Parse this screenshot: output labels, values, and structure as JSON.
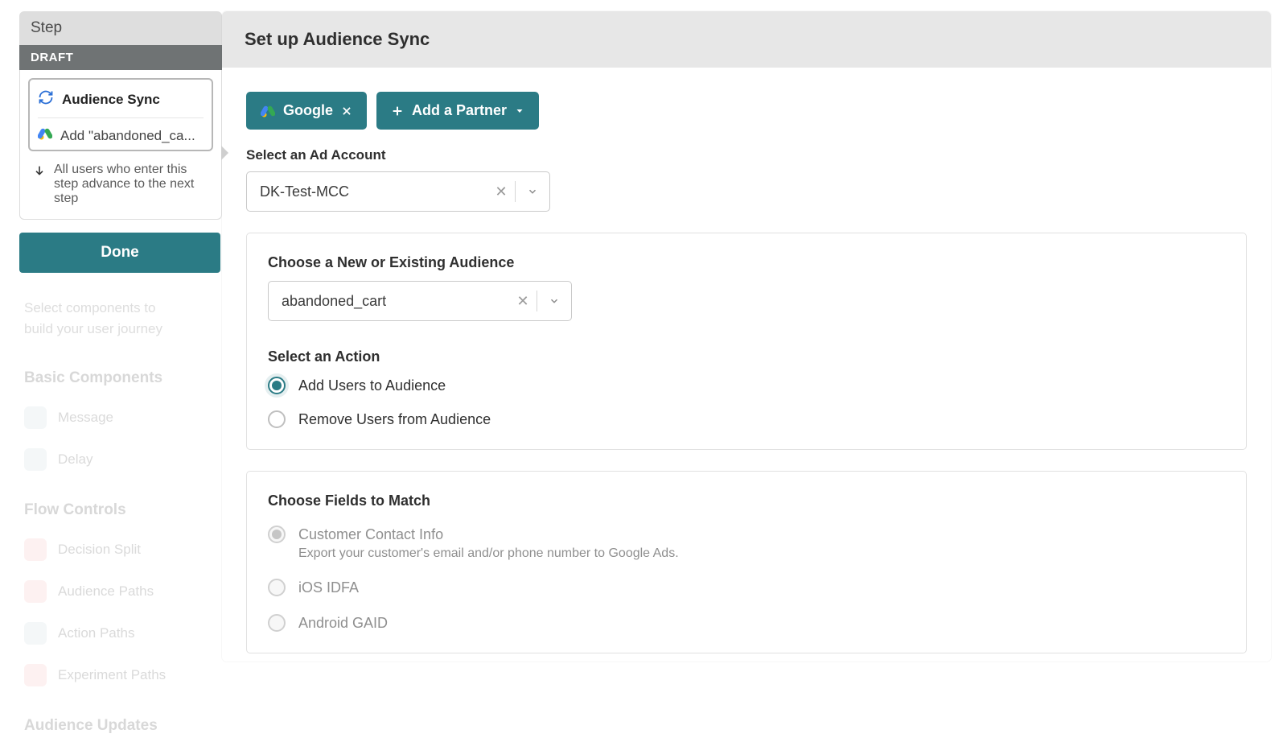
{
  "side": {
    "step_label": "Step",
    "draft_label": "DRAFT",
    "card_title": "Audience Sync",
    "card_sub": "Add \"abandoned_ca...",
    "advance_text": "All users who enter this step advance to the next step",
    "done_label": "Done"
  },
  "panel": {
    "title": "Set up Audience Sync",
    "chip_google": "Google",
    "chip_add_partner": "Add a Partner",
    "ad_account_label": "Select an Ad Account",
    "ad_account_value": "DK-Test-MCC",
    "audience_label": "Choose a New or Existing Audience",
    "audience_value": "abandoned_cart",
    "action_label": "Select an Action",
    "action_add": "Add Users to Audience",
    "action_remove": "Remove Users from Audience",
    "fields_label": "Choose Fields to Match",
    "field_contact": "Customer Contact Info",
    "field_contact_desc": "Export your customer's email and/or phone number to Google Ads.",
    "field_idfa": "iOS IDFA",
    "field_gaid": "Android GAID"
  },
  "bg": {
    "hint1": "Select components to",
    "hint2": "build your user journey",
    "sec1": "Basic Components",
    "i_message": "Message",
    "i_delay": "Delay",
    "sec2": "Flow Controls",
    "i_decision": "Decision Split",
    "i_audpaths": "Audience Paths",
    "i_actpaths": "Action Paths",
    "i_exppaths": "Experiment Paths",
    "sec3": "Audience Updates"
  }
}
